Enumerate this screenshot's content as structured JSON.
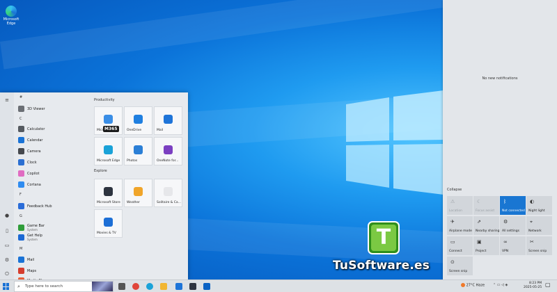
{
  "desktop": {
    "icon_label": "Microsoft Edge"
  },
  "watermark": {
    "logo_letter": "T",
    "text": "TuSoftware.es"
  },
  "start_menu": {
    "apps": [
      {
        "type": "letter",
        "label": "#"
      },
      {
        "type": "app",
        "label": "3D Viewer",
        "color": "#6b6f75"
      },
      {
        "type": "letter",
        "label": "C"
      },
      {
        "type": "app",
        "label": "Calculator",
        "color": "#555a60"
      },
      {
        "type": "app",
        "label": "Calendar",
        "color": "#1a73d6"
      },
      {
        "type": "app",
        "label": "Camera",
        "color": "#45484d"
      },
      {
        "type": "app",
        "label": "Clock",
        "color": "#2b6fd1"
      },
      {
        "type": "app",
        "label": "Copilot",
        "color": "#e06cc2"
      },
      {
        "type": "app",
        "label": "Cortana",
        "color": "#2f8cf0"
      },
      {
        "type": "letter",
        "label": "F"
      },
      {
        "type": "app",
        "label": "Feedback Hub",
        "color": "#2a6cd8"
      },
      {
        "type": "letter",
        "label": "G"
      },
      {
        "type": "app",
        "label": "Game Bar",
        "sub": "System",
        "color": "#2f9d3a"
      },
      {
        "type": "app",
        "label": "Get Help",
        "sub": "System",
        "color": "#1c69d4"
      },
      {
        "type": "letter",
        "label": "M"
      },
      {
        "type": "app",
        "label": "Mail",
        "color": "#1a73d6"
      },
      {
        "type": "app",
        "label": "Maps",
        "color": "#d53d2e"
      },
      {
        "type": "app",
        "label": "Media Player",
        "color": "#e8603a"
      }
    ],
    "groups": [
      {
        "title": "Productivity",
        "tiles": [
          {
            "label": "Microsoft 365",
            "color": "#3a8ee6"
          },
          {
            "label": "OneDrive",
            "color": "#1f7fe0"
          },
          {
            "label": "Mail",
            "color": "#1e74d8"
          },
          {
            "label": "Microsoft Edge",
            "color": "#1aa2d8"
          },
          {
            "label": "Photos",
            "color": "#2b7fd6"
          },
          {
            "label": "OneNote for...",
            "color": "#7b3fc1"
          }
        ]
      },
      {
        "title": "Explore",
        "tiles": [
          {
            "label": "Microsoft Store",
            "color": "#2e3440"
          },
          {
            "label": "Weather",
            "color": "#f0a52a"
          },
          {
            "label": "Solitaire & Ca...",
            "color": "#e6e7ea"
          },
          {
            "label": "Movies & TV",
            "color": "#1d6fd6"
          }
        ]
      }
    ],
    "m365_badge": "M365"
  },
  "action_center": {
    "no_notifications": "No new notifications",
    "collapse": "Collapse",
    "quick_actions": [
      {
        "label": "Location",
        "icon": "location-icon",
        "glyph": "⚠",
        "state": "dim"
      },
      {
        "label": "Focus assist",
        "icon": "moon-icon",
        "glyph": "☾",
        "state": "dim"
      },
      {
        "label": "Not connected",
        "icon": "bluetooth-icon",
        "glyph": "ᛒ",
        "state": "active"
      },
      {
        "label": "Night light",
        "icon": "brightness-icon",
        "glyph": "◐",
        "state": "normal"
      },
      {
        "label": "Airplane mode",
        "icon": "airplane-icon",
        "glyph": "✈",
        "state": "normal"
      },
      {
        "label": "Nearby sharing",
        "icon": "share-icon",
        "glyph": "⇗",
        "state": "normal"
      },
      {
        "label": "All settings",
        "icon": "gear-icon",
        "glyph": "⚙",
        "state": "normal"
      },
      {
        "label": "Network",
        "icon": "network-icon",
        "glyph": "⌖",
        "state": "normal"
      },
      {
        "label": "Connect",
        "icon": "cast-icon",
        "glyph": "▭",
        "state": "normal"
      },
      {
        "label": "Project",
        "icon": "project-icon",
        "glyph": "▣",
        "state": "normal"
      },
      {
        "label": "VPN",
        "icon": "vpn-icon",
        "glyph": "∞",
        "state": "normal"
      },
      {
        "label": "Screen snip",
        "icon": "snip-icon",
        "glyph": "✂",
        "state": "normal"
      },
      {
        "label": "Screen snip",
        "icon": "screenshot-icon",
        "glyph": "⊙",
        "state": "normal"
      }
    ]
  },
  "taskbar": {
    "search_placeholder": "Type here to search",
    "weather": "27°C  Haze",
    "time": "8:23 PM",
    "date": "2025-05-25",
    "icons": [
      {
        "name": "task-view-icon",
        "color": "#555"
      },
      {
        "name": "chrome-icon",
        "color": "#e0453a"
      },
      {
        "name": "edge-icon",
        "color": "#1aa2d8"
      },
      {
        "name": "file-explorer-icon",
        "color": "#f2b632"
      },
      {
        "name": "mail-icon",
        "color": "#1e74d8"
      },
      {
        "name": "store-icon",
        "color": "#2e3440"
      },
      {
        "name": "outlook-icon",
        "color": "#0b62c4"
      }
    ]
  }
}
